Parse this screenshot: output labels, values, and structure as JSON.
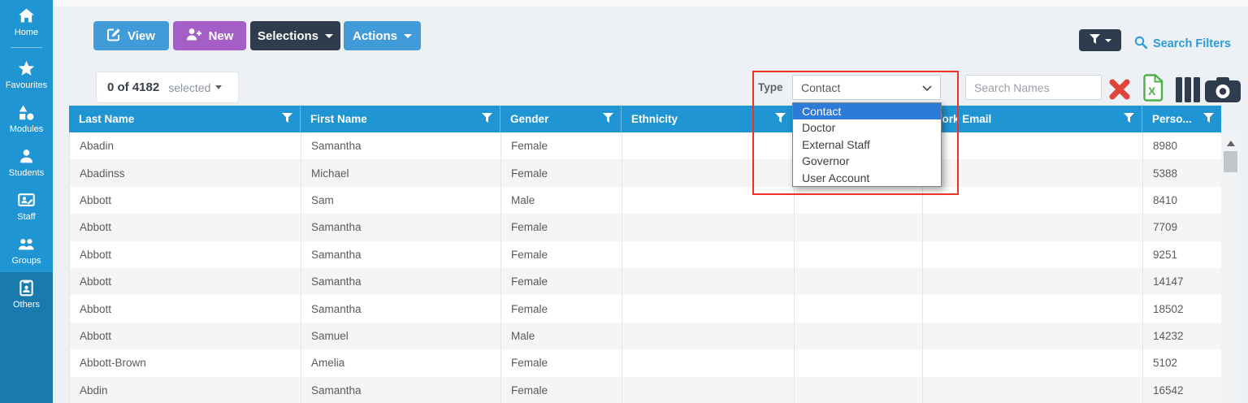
{
  "sidebar": {
    "items": [
      {
        "id": "home",
        "label": "Home",
        "icon": "home-icon",
        "active": false
      },
      {
        "id": "favourites",
        "label": "Favourites",
        "icon": "star-icon",
        "active": false
      },
      {
        "id": "modules",
        "label": "Modules",
        "icon": "shapes-icon",
        "active": false
      },
      {
        "id": "students",
        "label": "Students",
        "icon": "person-icon",
        "active": false
      },
      {
        "id": "staff",
        "label": "Staff",
        "icon": "staff-screen-icon",
        "active": false
      },
      {
        "id": "groups",
        "label": "Groups",
        "icon": "people-icon",
        "active": false
      },
      {
        "id": "others",
        "label": "Others",
        "icon": "badge-icon",
        "active": true
      }
    ]
  },
  "toolbar": {
    "view_label": "View",
    "new_label": "New",
    "selections_label": "Selections",
    "actions_label": "Actions",
    "search_filters_label": "Search Filters"
  },
  "filter_bar": {
    "selection_count": "0 of 4182",
    "selected_label": "selected",
    "type_label": "Type",
    "type_value": "Contact",
    "type_options": [
      "Contact",
      "Doctor",
      "External Staff",
      "Governor",
      "User Account"
    ],
    "type_selected_option": "Contact",
    "names_placeholder": "Search Names"
  },
  "table": {
    "columns": [
      "Last Name",
      "First Name",
      "Gender",
      "Ethnicity",
      "",
      "Work Email",
      "Perso..."
    ],
    "rows": [
      [
        "Abadin",
        "Samantha",
        "Female",
        "",
        "",
        "",
        "8980"
      ],
      [
        "Abadinss",
        "Michael",
        "Female",
        "",
        "",
        "",
        "5388"
      ],
      [
        "Abbott",
        "Sam",
        "Male",
        "",
        "",
        "",
        "8410"
      ],
      [
        "Abbott",
        "Samantha",
        "Female",
        "",
        "",
        "",
        "7709"
      ],
      [
        "Abbott",
        "Samantha",
        "Female",
        "",
        "",
        "",
        "9251"
      ],
      [
        "Abbott",
        "Samantha",
        "Female",
        "",
        "",
        "",
        "14147"
      ],
      [
        "Abbott",
        "Samantha",
        "Female",
        "",
        "",
        "",
        "18502"
      ],
      [
        "Abbott",
        "Samuel",
        "Male",
        "",
        "",
        "",
        "14232"
      ],
      [
        "Abbott-Brown",
        "Amelia",
        "Female",
        "",
        "",
        "",
        "5102"
      ],
      [
        "Abdin",
        "Samantha",
        "Female",
        "",
        "",
        "",
        "16542"
      ]
    ]
  },
  "icons": {
    "view_button": "edit-icon",
    "new_button": "user-plus-icon",
    "selections_button": "caret-down-icon",
    "actions_button": "caret-down-icon",
    "filter_split_button": "filter-funnel-icon",
    "search_filters": "search-icon",
    "type_select": "chevron-down-icon",
    "clear_filter": "red-x-icon",
    "export_excel": "excel-export-icon",
    "column_chooser": "columns-icon",
    "snapshot": "camera-icon",
    "column_header": "filter-funnel-icon",
    "scrollbar": "scroll-up-icon"
  },
  "colors": {
    "header_blue": "#2095d3",
    "sidebar_active": "#187aad",
    "button_blue": "#409bd8",
    "button_purple": "#a55ec6",
    "button_dark": "#2e3c4d",
    "link_blue": "#2b9cd8",
    "danger_red": "#e0443a",
    "excel_green": "#4db049",
    "annotation_red": "#ee3124",
    "dropdown_highlight": "#2d7bd9"
  }
}
